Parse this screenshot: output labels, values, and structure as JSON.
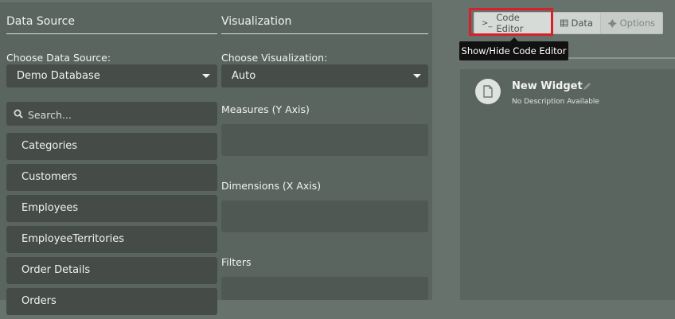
{
  "data_source": {
    "section_title": "Data Source",
    "choose_label": "Choose Data Source:",
    "selected": "Demo Database",
    "search_placeholder": "Search...",
    "tables": [
      "Categories",
      "Customers",
      "Employees",
      "EmployeeTerritories",
      "Order Details",
      "Orders"
    ]
  },
  "visualization": {
    "section_title": "Visualization",
    "choose_label": "Choose Visualization:",
    "selected": "Auto",
    "measures_label": "Measures (Y Axis)",
    "dimensions_label": "Dimensions (X Axis)",
    "filters_label": "Filters"
  },
  "toolbar": {
    "code_editor_label": "Code Editor",
    "code_editor_prefix": ">_",
    "data_label": "Data",
    "options_label": "Options",
    "tooltip": "Show/Hide Code Editor"
  },
  "widget": {
    "title": "New Widget",
    "description": "No Description Available"
  },
  "colors": {
    "highlight": "#d8202a",
    "panel": "#5b655f",
    "background": "#66726b"
  }
}
